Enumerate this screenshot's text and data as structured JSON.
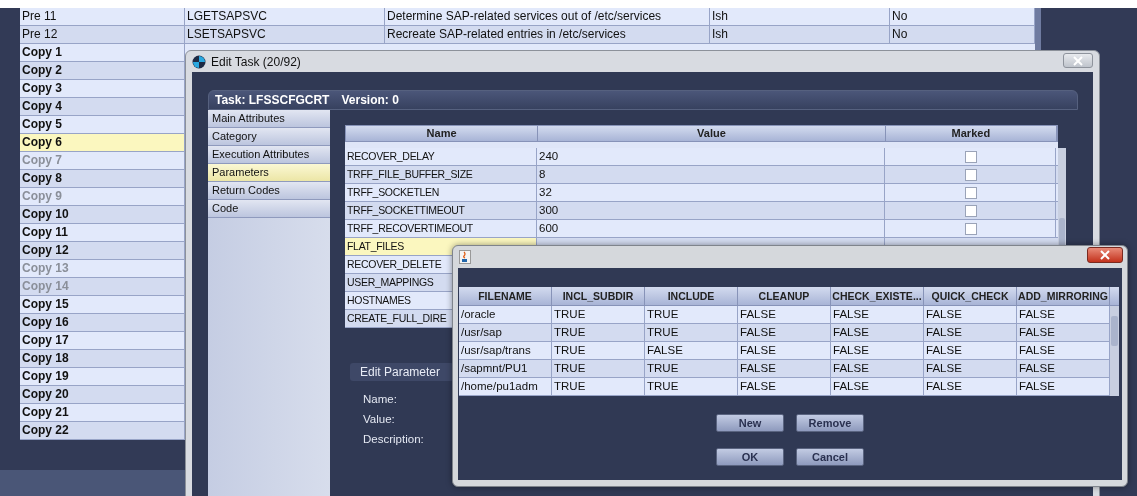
{
  "background_table": {
    "rows": [
      {
        "kind": "pre",
        "selected": false,
        "disabled": false,
        "cells": [
          "Pre 11",
          "LGETSAPSVC",
          "Determine SAP-related services out of /etc/services",
          "Ish",
          "No"
        ]
      },
      {
        "kind": "pre",
        "selected": false,
        "disabled": false,
        "cells": [
          "Pre 12",
          "LSETSAPSVC",
          "Recreate SAP-related entries in /etc/services",
          "Ish",
          "No"
        ]
      },
      {
        "kind": "copy",
        "selected": false,
        "disabled": false,
        "cells": [
          "Copy 1"
        ]
      },
      {
        "kind": "copy",
        "selected": false,
        "disabled": false,
        "cells": [
          "Copy 2"
        ]
      },
      {
        "kind": "copy",
        "selected": false,
        "disabled": false,
        "cells": [
          "Copy 3"
        ]
      },
      {
        "kind": "copy",
        "selected": false,
        "disabled": false,
        "cells": [
          "Copy 4"
        ]
      },
      {
        "kind": "copy",
        "selected": false,
        "disabled": false,
        "cells": [
          "Copy 5"
        ]
      },
      {
        "kind": "copy",
        "selected": true,
        "disabled": false,
        "cells": [
          "Copy 6"
        ]
      },
      {
        "kind": "copy",
        "selected": false,
        "disabled": true,
        "cells": [
          "Copy 7"
        ]
      },
      {
        "kind": "copy",
        "selected": false,
        "disabled": false,
        "cells": [
          "Copy 8"
        ]
      },
      {
        "kind": "copy",
        "selected": false,
        "disabled": true,
        "cells": [
          "Copy 9"
        ]
      },
      {
        "kind": "copy",
        "selected": false,
        "disabled": false,
        "cells": [
          "Copy 10"
        ]
      },
      {
        "kind": "copy",
        "selected": false,
        "disabled": false,
        "cells": [
          "Copy 11"
        ]
      },
      {
        "kind": "copy",
        "selected": false,
        "disabled": false,
        "cells": [
          "Copy 12"
        ]
      },
      {
        "kind": "copy",
        "selected": false,
        "disabled": true,
        "cells": [
          "Copy 13"
        ]
      },
      {
        "kind": "copy",
        "selected": false,
        "disabled": true,
        "cells": [
          "Copy 14"
        ]
      },
      {
        "kind": "copy",
        "selected": false,
        "disabled": false,
        "cells": [
          "Copy 15"
        ]
      },
      {
        "kind": "copy",
        "selected": false,
        "disabled": false,
        "cells": [
          "Copy 16"
        ]
      },
      {
        "kind": "copy",
        "selected": false,
        "disabled": false,
        "cells": [
          "Copy 17"
        ]
      },
      {
        "kind": "copy",
        "selected": false,
        "disabled": false,
        "cells": [
          "Copy 18"
        ]
      },
      {
        "kind": "copy",
        "selected": false,
        "disabled": false,
        "cells": [
          "Copy 19"
        ]
      },
      {
        "kind": "copy",
        "selected": false,
        "disabled": false,
        "cells": [
          "Copy 20"
        ]
      },
      {
        "kind": "copy",
        "selected": false,
        "disabled": false,
        "cells": [
          "Copy 21"
        ]
      },
      {
        "kind": "copy",
        "selected": false,
        "disabled": false,
        "cells": [
          "Copy 22"
        ]
      }
    ]
  },
  "edit_task": {
    "title": "Edit Task (20/92)",
    "task_label": "Task: LFSSCFGCRT",
    "version_label": "Version: 0",
    "nav": [
      {
        "label": "Main Attributes",
        "selected": false
      },
      {
        "label": "Category",
        "selected": false
      },
      {
        "label": "Execution Attributes",
        "selected": false
      },
      {
        "label": "Parameters",
        "selected": true
      },
      {
        "label": "Return Codes",
        "selected": false
      },
      {
        "label": "Code",
        "selected": false
      }
    ],
    "parameters": {
      "columns": [
        "Name",
        "Value",
        "Marked"
      ],
      "rows": [
        {
          "name": "RECOVER_DELAY",
          "value": "240",
          "checked": false,
          "selected": false
        },
        {
          "name": "TRFF_FILE_BUFFER_SIZE",
          "value": "8",
          "checked": false,
          "selected": false
        },
        {
          "name": "TRFF_SOCKETLEN",
          "value": "32",
          "checked": false,
          "selected": false
        },
        {
          "name": "TRFF_SOCKETTIMEOUT",
          "value": "300",
          "checked": false,
          "selected": false
        },
        {
          "name": "TRFF_RECOVERTIMEOUT",
          "value": "600",
          "checked": false,
          "selected": false
        },
        {
          "name": "FLAT_FILES",
          "selected": true
        },
        {
          "name": "RECOVER_DELETE",
          "selected": false
        },
        {
          "name": "USER_MAPPINGS",
          "selected": false
        },
        {
          "name": "HOSTNAMES",
          "selected": false
        },
        {
          "name": "CREATE_FULL_DIRE",
          "selected": false
        }
      ]
    },
    "edit_parameter": {
      "title": "Edit Parameter",
      "labels": [
        "Name:",
        "Value:",
        "Description:"
      ]
    }
  },
  "dialog": {
    "table": {
      "columns": [
        "FILENAME",
        "INCL_SUBDIR",
        "INCLUDE",
        "CLEANUP",
        "CHECK_EXISTE...",
        "QUICK_CHECK",
        "ADD_MIRRORING"
      ],
      "rows": [
        [
          "/oracle",
          "TRUE",
          "TRUE",
          "FALSE",
          "FALSE",
          "FALSE",
          "FALSE"
        ],
        [
          "/usr/sap",
          "TRUE",
          "TRUE",
          "FALSE",
          "FALSE",
          "FALSE",
          "FALSE"
        ],
        [
          "/usr/sap/trans",
          "TRUE",
          "FALSE",
          "FALSE",
          "FALSE",
          "FALSE",
          "FALSE"
        ],
        [
          "/sapmnt/PU1",
          "TRUE",
          "TRUE",
          "FALSE",
          "FALSE",
          "FALSE",
          "FALSE"
        ],
        [
          "/home/pu1adm",
          "TRUE",
          "TRUE",
          "FALSE",
          "FALSE",
          "FALSE",
          "FALSE"
        ]
      ]
    },
    "buttons": [
      "New",
      "Remove"
    ],
    "footer_buttons": [
      "OK",
      "Cancel"
    ]
  }
}
